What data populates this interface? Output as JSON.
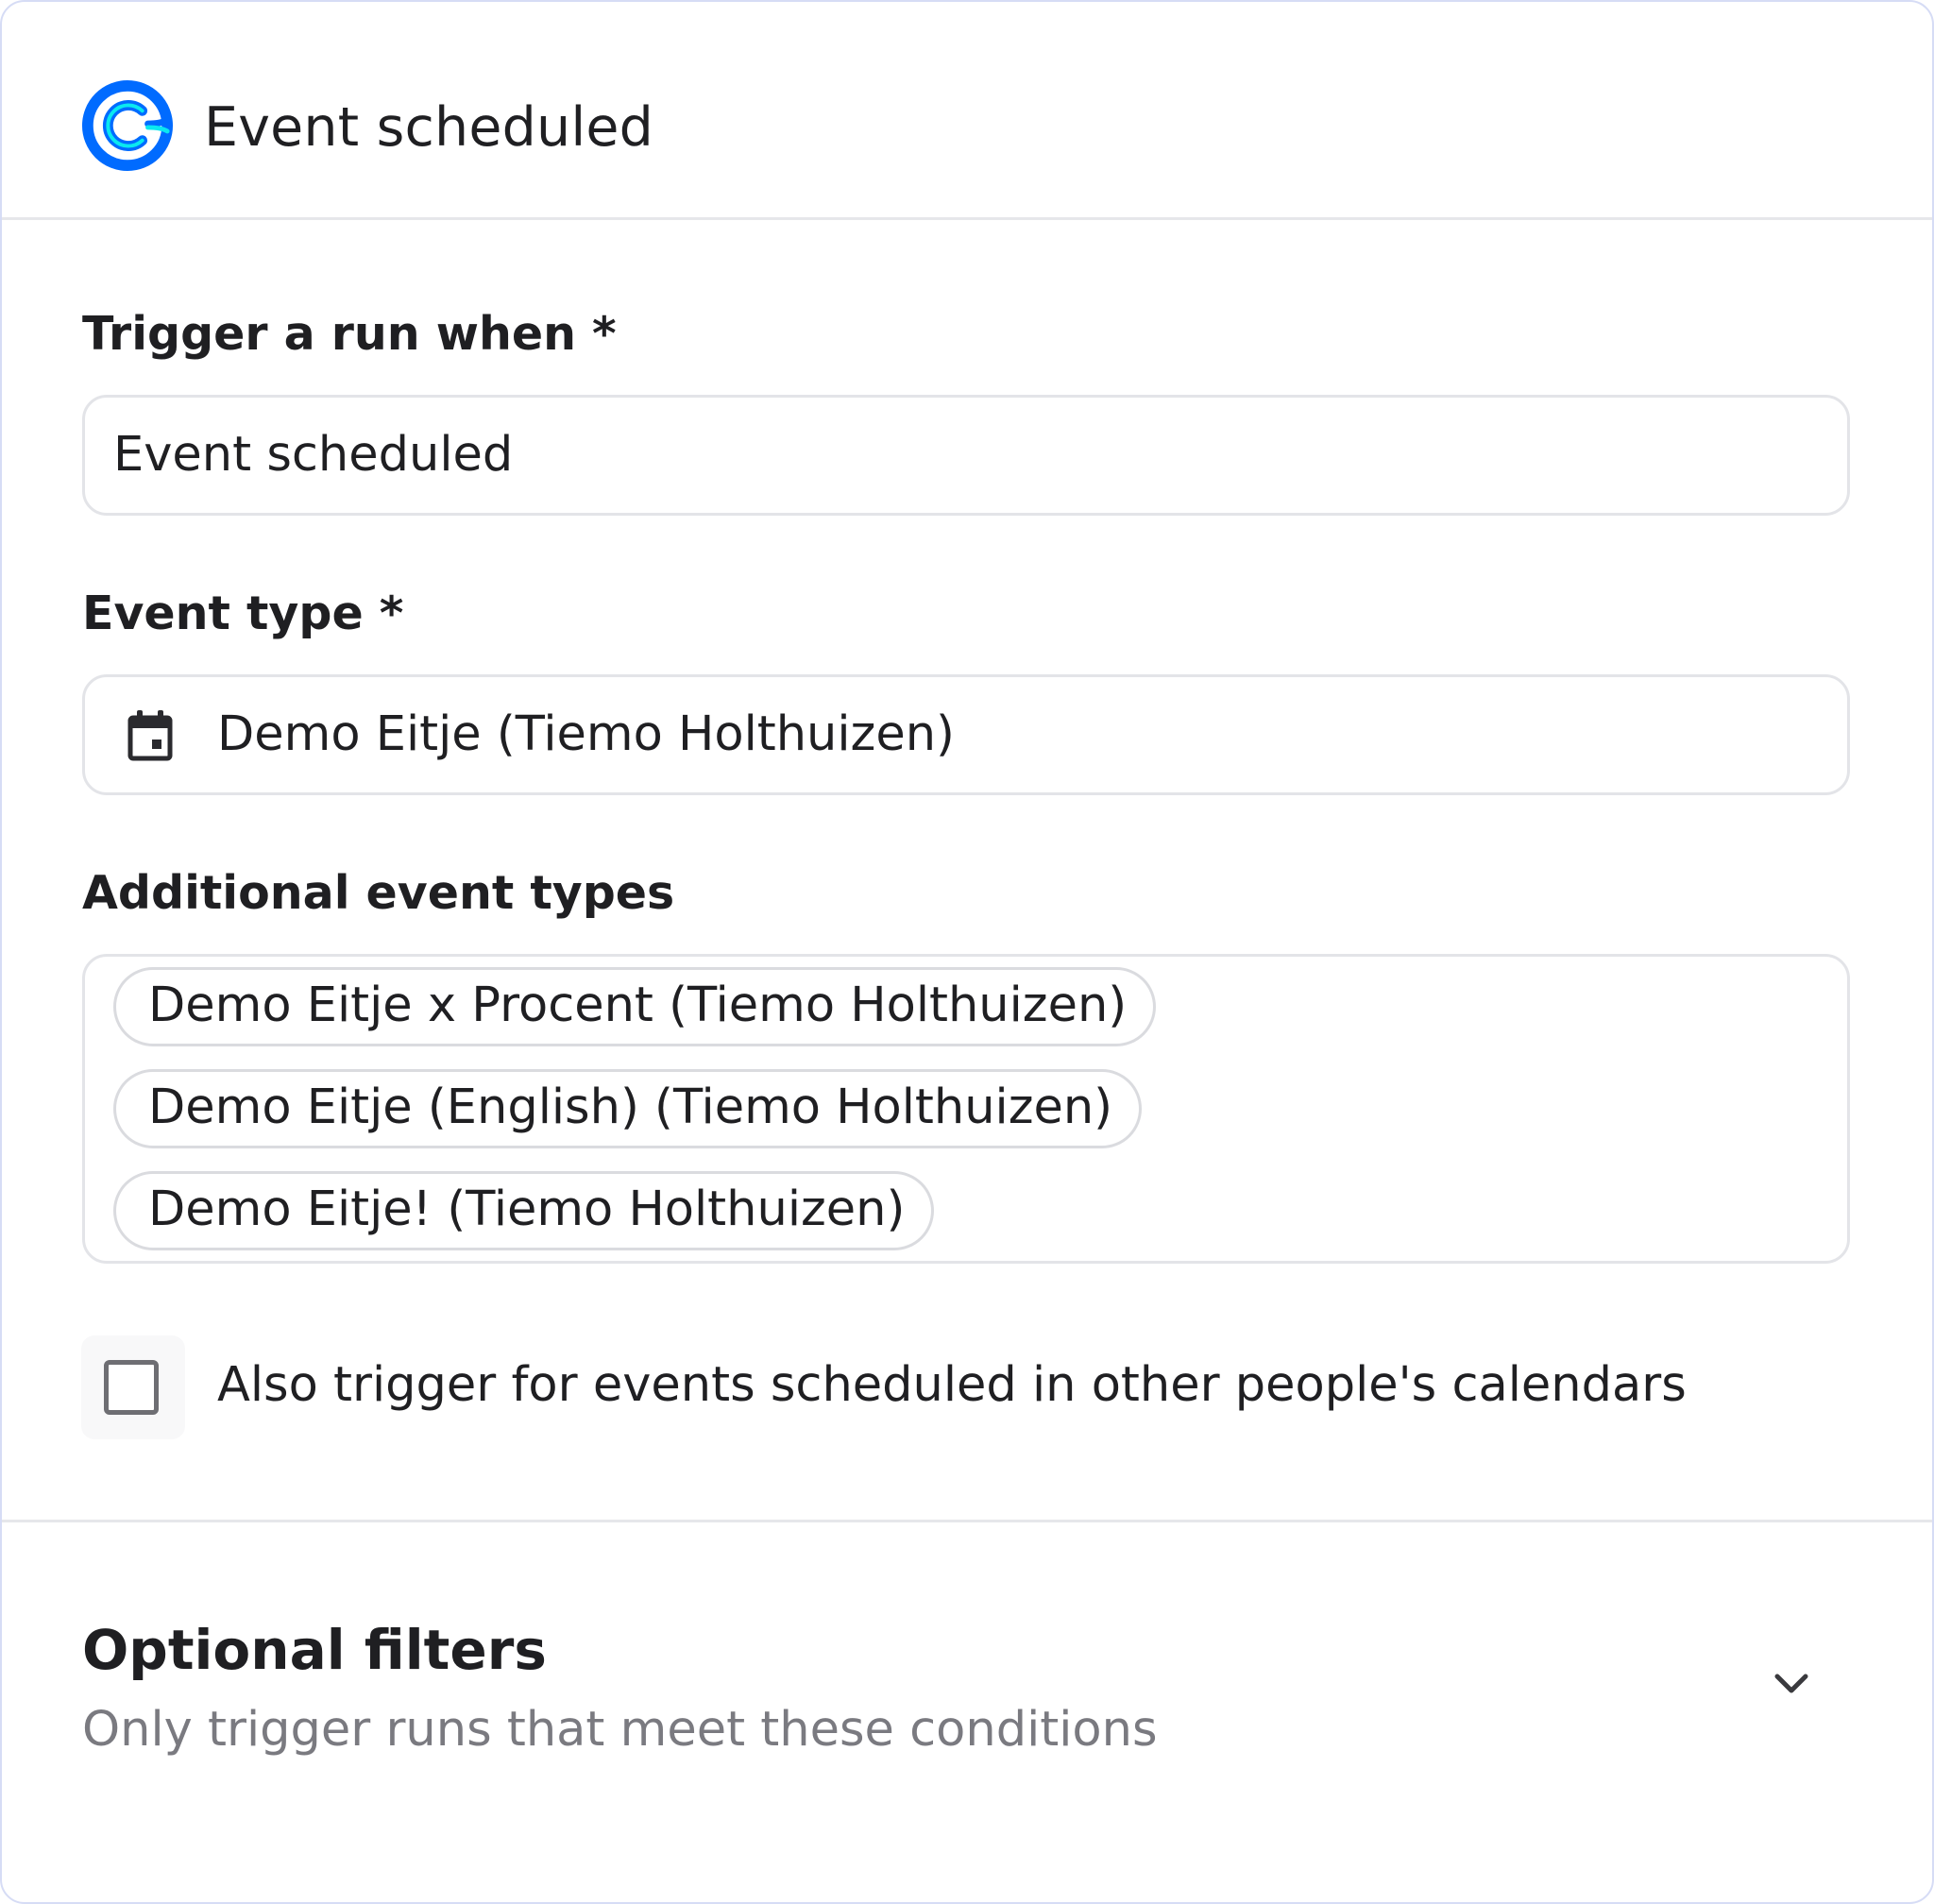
{
  "header": {
    "app_icon": "calendly-icon",
    "title": "Event scheduled"
  },
  "trigger": {
    "label": "Trigger a run when *",
    "value": "Event scheduled"
  },
  "event_type": {
    "label": "Event type *",
    "icon": "calendar-icon",
    "value": "Demo Eitje (Tiemo Holthuizen)"
  },
  "additional": {
    "label": "Additional event types",
    "chips": [
      "Demo Eitje x Procent (Tiemo Holthuizen)",
      "Demo Eitje (English) (Tiemo Holthuizen)",
      "Demo Eitje! (Tiemo Holthuizen)"
    ]
  },
  "other_calendars": {
    "label": "Also trigger for events scheduled in other people's calendars",
    "checked": false
  },
  "filters": {
    "title": "Optional filters",
    "subtitle": "Only trigger runs that meet these conditions",
    "icon": "chevron-down-icon"
  },
  "colors": {
    "accent": "#006BFF",
    "accent_secondary": "#0AE8F0",
    "panel_border": "#D6DCF5",
    "muted_text": "#7A7A80"
  }
}
